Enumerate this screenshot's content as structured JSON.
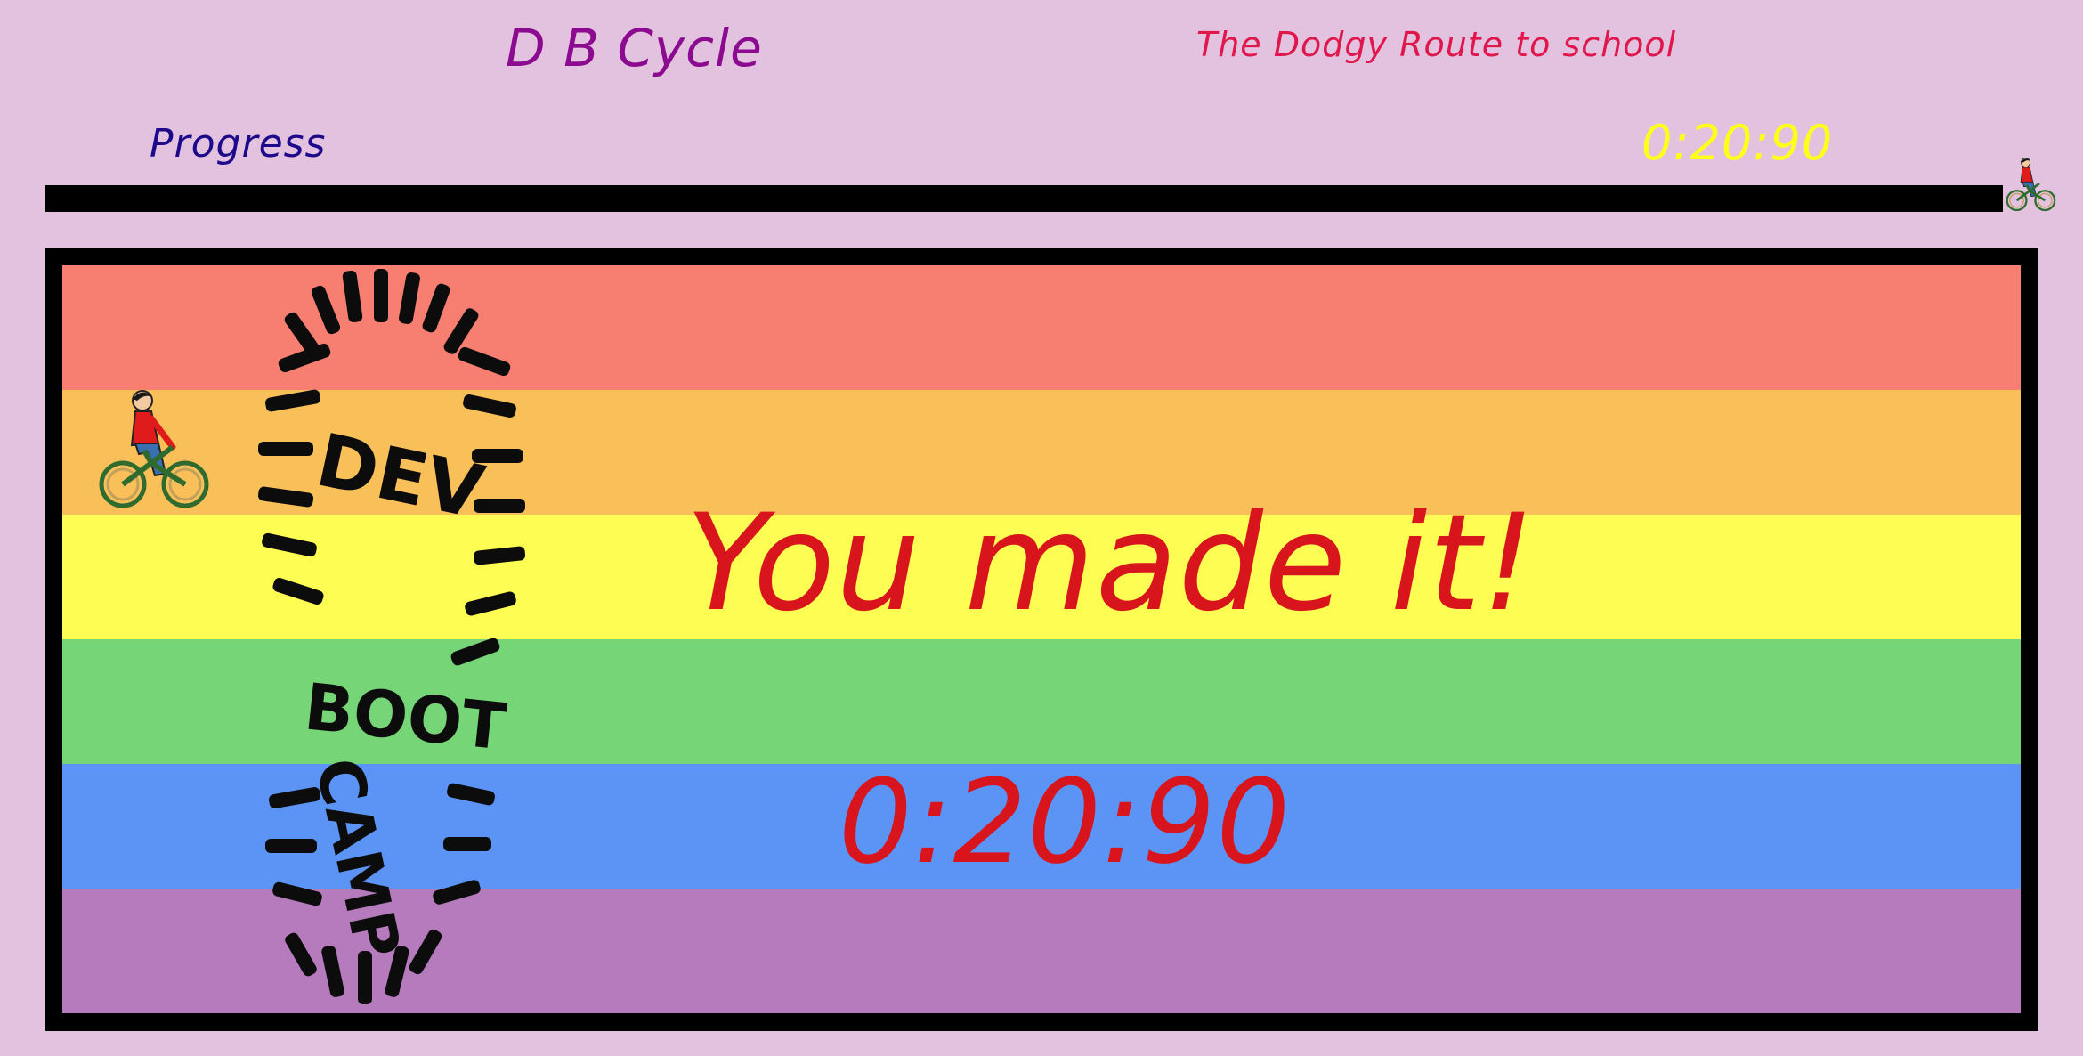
{
  "header": {
    "app_title": "D B Cycle",
    "subtitle": "The Dodgy Route to school"
  },
  "progress": {
    "label": "Progress",
    "timer": "0:20:90",
    "fraction": 1.0,
    "bar_color": "#000000"
  },
  "game": {
    "stripe_colors": [
      "#f67f72",
      "#f9c05a",
      "#fdfd53",
      "#76d576",
      "#5b94f4",
      "#b57bbd"
    ],
    "logo_text": [
      "DEV",
      "BOOT",
      "CAMP"
    ],
    "message": "You made it!",
    "final_time": "0:20:90",
    "message_color": "#d8141c"
  },
  "icons": {
    "player": "bicycle-rider-icon",
    "progress_marker": "bicycle-rider-icon",
    "logo": "boot-print-logo"
  }
}
